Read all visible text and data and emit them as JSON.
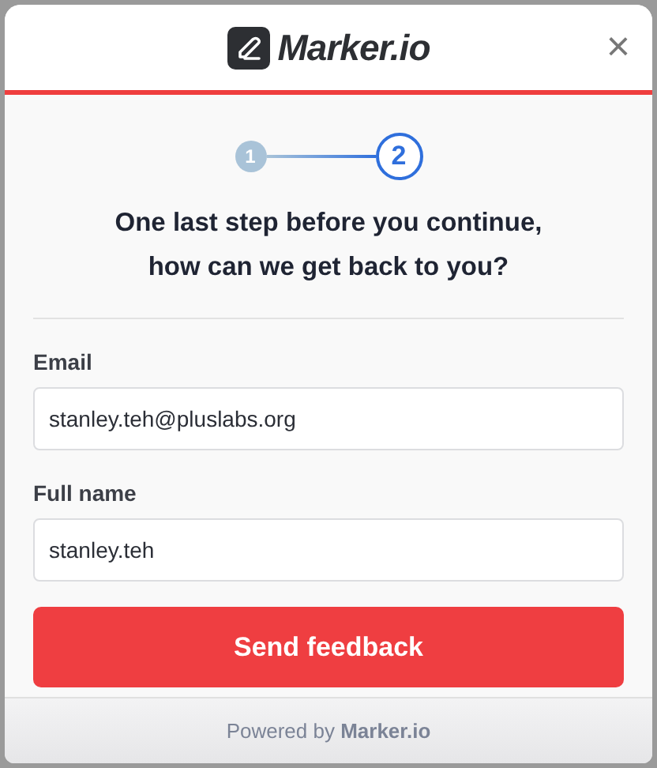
{
  "header": {
    "logo_text": "Marker.io",
    "close": "×"
  },
  "steps": [
    {
      "label": "1",
      "selected": false
    },
    {
      "label": "2",
      "selected": true
    }
  ],
  "heading": [
    "One last step before you continue,",
    "how can we get back to you?"
  ],
  "fields": [
    {
      "label": "Email",
      "value": "stanley.teh@pluslabs.org"
    },
    {
      "label": "Full name",
      "value": "stanley.teh"
    }
  ],
  "submit": "Send feedback",
  "footer": "Powered by **Marker.io**"
}
